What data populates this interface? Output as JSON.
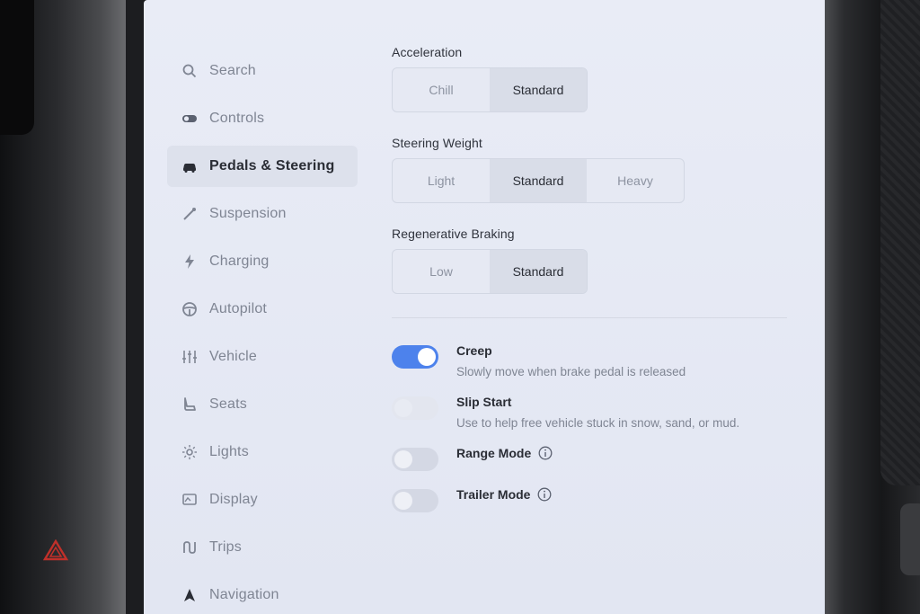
{
  "sidebar": {
    "items": [
      {
        "label": "Search",
        "icon": "search-icon"
      },
      {
        "label": "Controls",
        "icon": "toggle-icon"
      },
      {
        "label": "Pedals & Steering",
        "icon": "car-icon",
        "active": true
      },
      {
        "label": "Suspension",
        "icon": "suspension-icon"
      },
      {
        "label": "Charging",
        "icon": "lightning-icon"
      },
      {
        "label": "Autopilot",
        "icon": "steering-wheel-icon"
      },
      {
        "label": "Vehicle",
        "icon": "sliders-icon"
      },
      {
        "label": "Seats",
        "icon": "seat-icon"
      },
      {
        "label": "Lights",
        "icon": "sun-icon"
      },
      {
        "label": "Display",
        "icon": "display-icon"
      },
      {
        "label": "Trips",
        "icon": "route-icon"
      },
      {
        "label": "Navigation",
        "icon": "navigation-arrow-icon"
      }
    ]
  },
  "acceleration": {
    "label": "Acceleration",
    "options": [
      "Chill",
      "Standard"
    ],
    "selected": "Standard"
  },
  "steering_weight": {
    "label": "Steering Weight",
    "options": [
      "Light",
      "Standard",
      "Heavy"
    ],
    "selected": "Standard"
  },
  "regen_braking": {
    "label": "Regenerative Braking",
    "options": [
      "Low",
      "Standard"
    ],
    "selected": "Standard"
  },
  "toggles": {
    "creep": {
      "title": "Creep",
      "description": "Slowly move when brake pedal is released",
      "on": true
    },
    "slip_start": {
      "title": "Slip Start",
      "description": "Use to help free vehicle stuck in snow, sand, or mud.",
      "on": false
    },
    "range_mode": {
      "title": "Range Mode",
      "on": false
    },
    "trailer_mode": {
      "title": "Trailer Mode",
      "on": false
    }
  },
  "colors": {
    "accent": "#4d82ec",
    "hazard": "#c0302a"
  }
}
